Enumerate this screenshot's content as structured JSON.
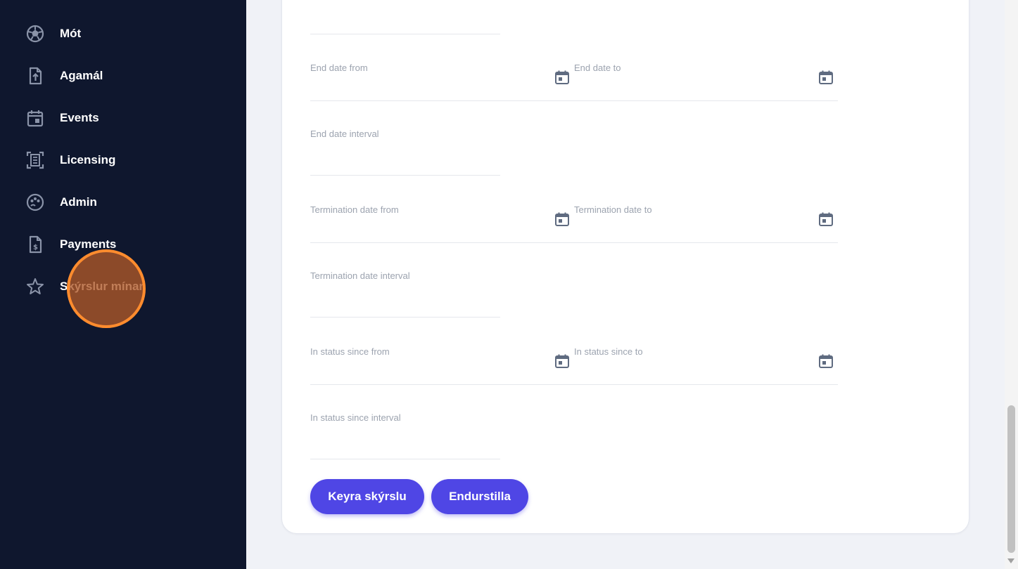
{
  "sidebar": {
    "items": [
      {
        "label": "Mót",
        "icon": "soccer-ball-icon"
      },
      {
        "label": "Agamál",
        "icon": "file-upload-icon"
      },
      {
        "label": "Events",
        "icon": "calendar-event-icon"
      },
      {
        "label": "Licensing",
        "icon": "license-document-icon"
      },
      {
        "label": "Admin",
        "icon": "palette-icon"
      },
      {
        "label": "Payments",
        "icon": "invoice-dollar-icon"
      },
      {
        "label": "Skýrslur mínar",
        "icon": "star-icon"
      }
    ]
  },
  "form": {
    "end_date_from": "End date from",
    "end_date_to": "End date to",
    "end_date_interval": "End date interval",
    "termination_date_from": "Termination date from",
    "termination_date_to": "Termination date to",
    "termination_date_interval": "Termination date interval",
    "in_status_since_from": "In status since from",
    "in_status_since_to": "In status since to",
    "in_status_since_interval": "In status since interval"
  },
  "buttons": {
    "run_report": "Keyra skýrslu",
    "reset": "Endurstilla"
  },
  "colors": {
    "sidebar_bg": "#0f172e",
    "accent": "#4f46e5",
    "click_marker": "#ff8c2e"
  }
}
